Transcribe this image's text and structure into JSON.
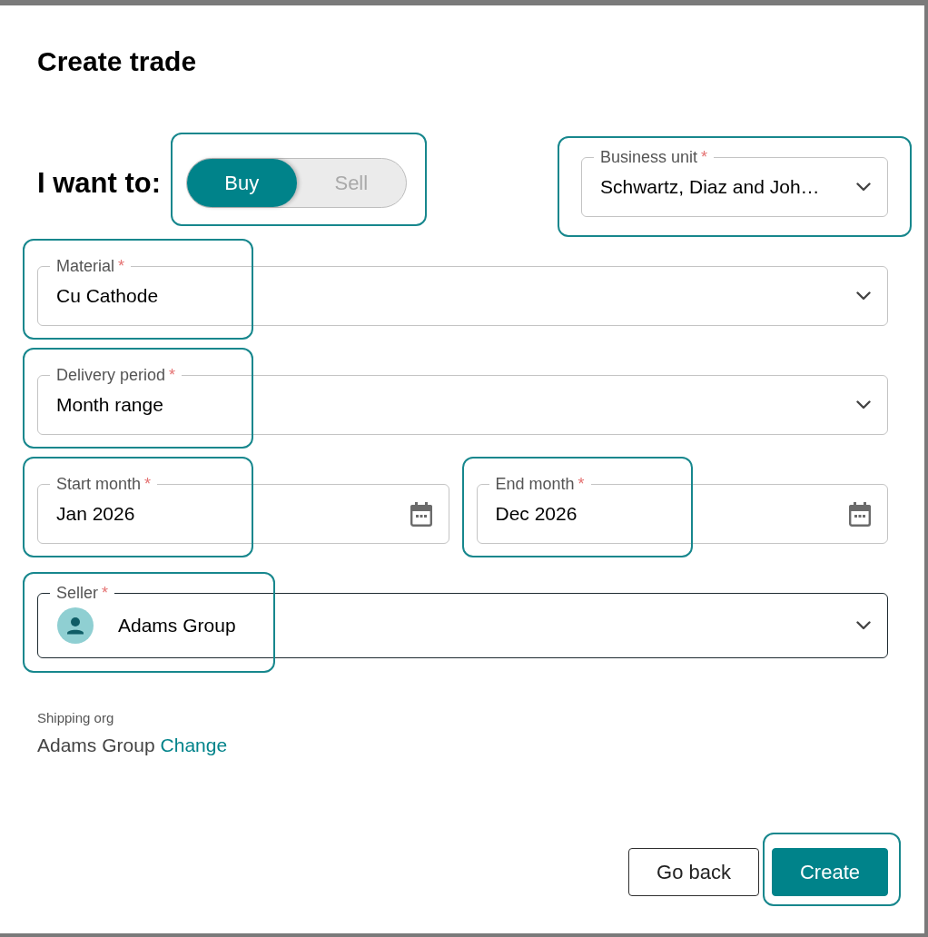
{
  "dialog": {
    "title": "Create trade"
  },
  "direction": {
    "label": "I want to:",
    "highlighted": true,
    "options": [
      {
        "label": "Buy",
        "selected": true
      },
      {
        "label": "Sell",
        "selected": false
      }
    ]
  },
  "business_unit": {
    "kind": "select",
    "label": "Business unit",
    "required_mark": "*",
    "value": "Schwartz, Diaz and Joh…",
    "focused": false,
    "highlighted": true
  },
  "material": {
    "kind": "select",
    "label": "Material",
    "required_mark": "*",
    "value": "Cu Cathode",
    "focused": false,
    "highlighted": true
  },
  "delivery_period": {
    "kind": "select",
    "label": "Delivery period",
    "required_mark": "*",
    "value": "Month range",
    "focused": false,
    "highlighted": true
  },
  "months": [
    {
      "kind": "date",
      "label": "Start month",
      "required_mark": "*",
      "value": "Jan 2026",
      "focused": false,
      "highlighted": true
    },
    {
      "kind": "date",
      "label": "End month",
      "required_mark": "*",
      "value": "Dec 2026",
      "focused": false,
      "highlighted": true
    }
  ],
  "seller": {
    "kind": "person",
    "label": "Seller",
    "required_mark": "*",
    "value": "Adams Group",
    "focused": true,
    "highlighted": true
  },
  "shipping_org": {
    "label": "Shipping org",
    "value": "Adams Group",
    "link": "Change"
  },
  "buttons": [
    {
      "kind": "secondary",
      "label": "Go back",
      "highlighted": false
    },
    {
      "kind": "primary",
      "label": "Create",
      "highlighted": true
    }
  ]
}
